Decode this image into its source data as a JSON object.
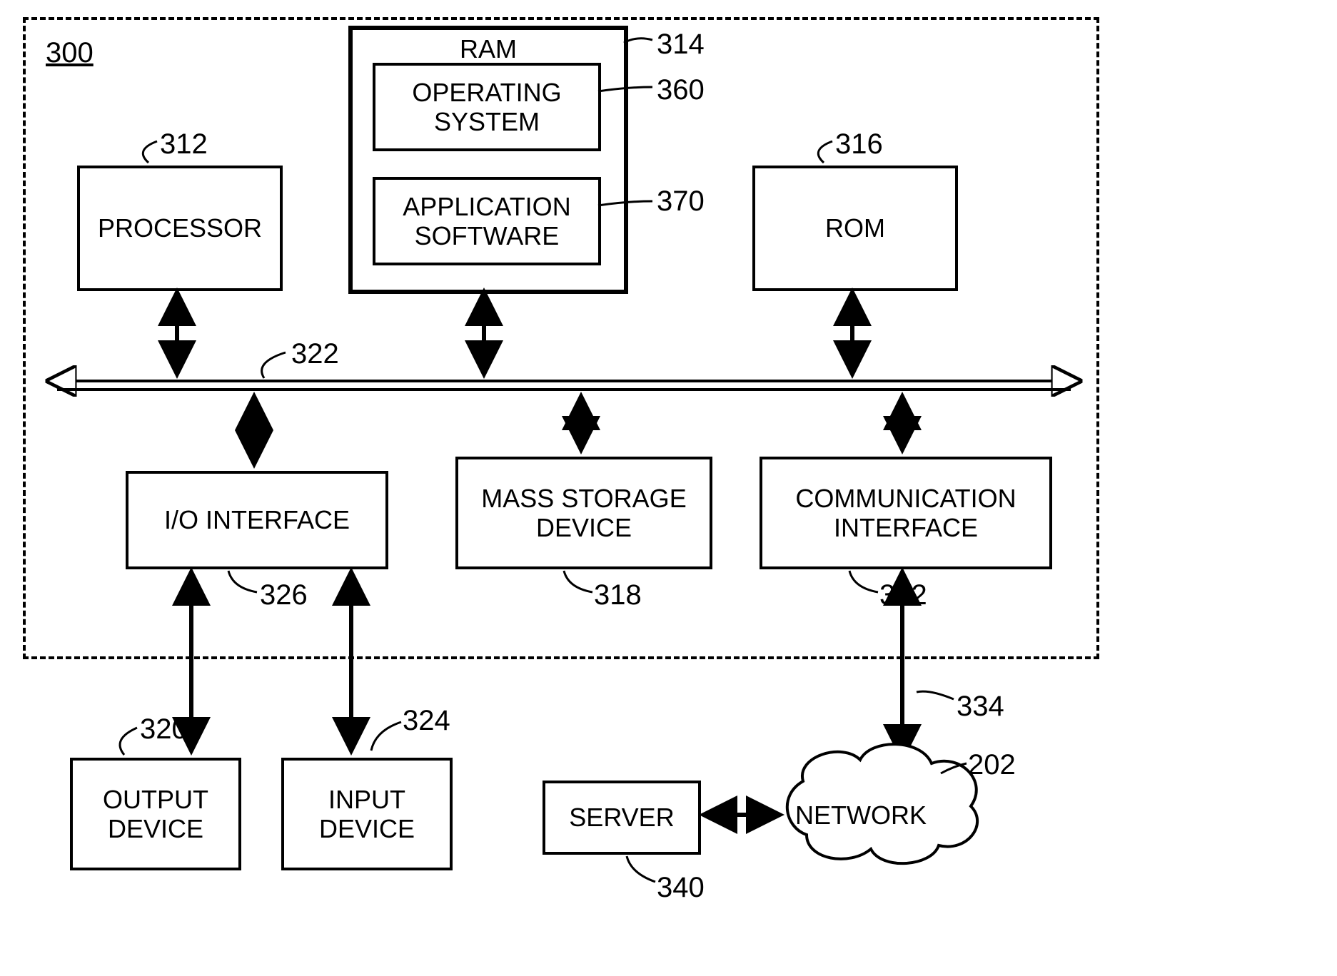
{
  "refs": {
    "system": "300",
    "processor": "312",
    "ram": "314",
    "rom": "316",
    "mass": "318",
    "output": "320",
    "bus": "322",
    "input": "324",
    "io": "326",
    "comm": "332",
    "link": "334",
    "server": "340",
    "os": "360",
    "app": "370",
    "network": "202"
  },
  "labels": {
    "processor": "PROCESSOR",
    "ram": "RAM",
    "os": "OPERATING SYSTEM",
    "app": "APPLICATION SOFTWARE",
    "rom": "ROM",
    "io": "I/O INTERFACE",
    "mass": "MASS STORAGE DEVICE",
    "comm": "COMMUNICATION INTERFACE",
    "output": "OUTPUT DEVICE",
    "input": "INPUT DEVICE",
    "server": "SERVER",
    "network": "NETWORK"
  }
}
